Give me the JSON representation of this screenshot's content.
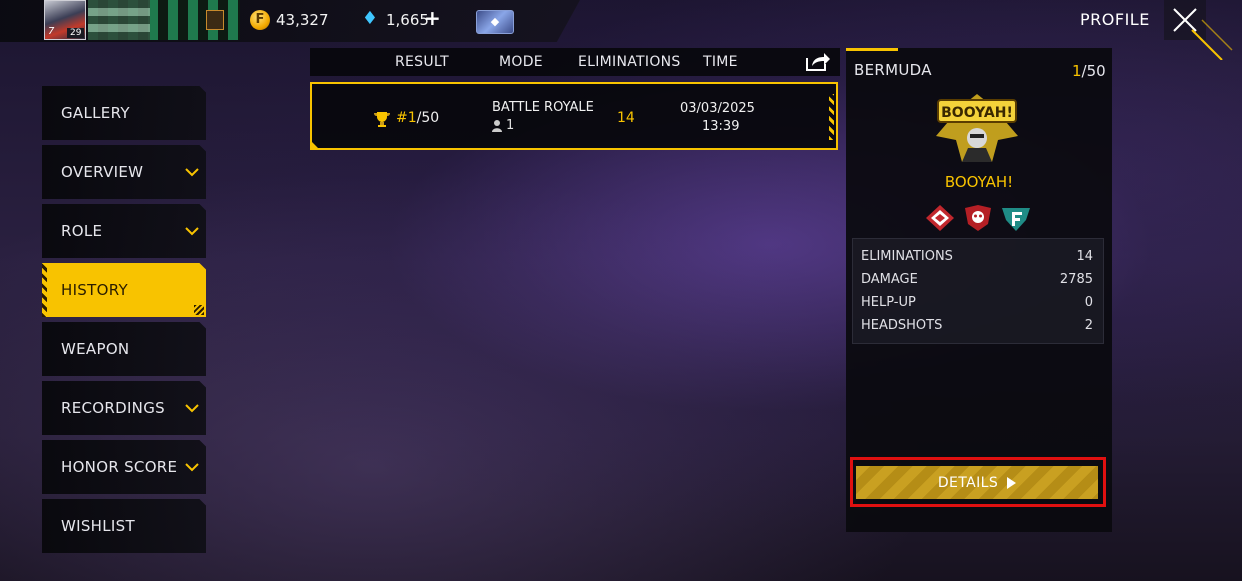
{
  "topbar": {
    "avatar_level": "29",
    "avatar_num": "7",
    "coin_symbol": "F",
    "gold": "43,327",
    "diamonds": "1,665",
    "plus": "+",
    "card_symbol": "◆"
  },
  "header": {
    "title": "PROFILE"
  },
  "sidebar": {
    "items": [
      {
        "label": "GALLERY",
        "has_chevron": false
      },
      {
        "label": "OVERVIEW",
        "has_chevron": true
      },
      {
        "label": "ROLE",
        "has_chevron": true
      },
      {
        "label": "HISTORY",
        "has_chevron": false,
        "active": true
      },
      {
        "label": "WEAPON",
        "has_chevron": false
      },
      {
        "label": "RECORDINGS",
        "has_chevron": true
      },
      {
        "label": "HONOR SCORE",
        "has_chevron": true
      },
      {
        "label": "WISHLIST",
        "has_chevron": false
      }
    ]
  },
  "history": {
    "columns": [
      "RESULT",
      "MODE",
      "ELIMINATIONS",
      "TIME"
    ],
    "rows": [
      {
        "rank_prefix": "#1",
        "rank_suffix": "/50",
        "mode": "BATTLE ROYALE",
        "squad_size": "1",
        "eliminations": "14",
        "date": "03/03/2025",
        "time": "13:39"
      }
    ]
  },
  "match_detail": {
    "map": "BERMUDA",
    "placement": "1",
    "placement_total": "/50",
    "booyah_art_text": "BOOYAH!",
    "result_label": "BOOYAH!",
    "stats": [
      {
        "label": "ELIMINATIONS",
        "value": "14"
      },
      {
        "label": "DAMAGE",
        "value": "2785"
      },
      {
        "label": "HELP-UP",
        "value": "0"
      },
      {
        "label": "HEADSHOTS",
        "value": "2"
      }
    ],
    "details_button": "DETAILS"
  },
  "colors": {
    "accent": "#f8c300",
    "highlight_box": "#e01010",
    "panel_bg": "#0a0a0e"
  }
}
